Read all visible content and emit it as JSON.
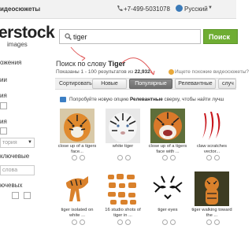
{
  "topbar": {
    "nav_text": "идеосюжеты",
    "phone": "+7-499-5031078",
    "language": "Русский",
    "language_caret": "▼"
  },
  "logo": {
    "wordmark": "erstock",
    "subtitle": "images"
  },
  "search": {
    "value": "tiger",
    "button_label": "Поиск"
  },
  "sidebar": {
    "lines": [
      "ожения",
      "ии",
      "ия",
      "ия",
      "тория",
      "ключевые",
      "слова",
      "ючевых"
    ],
    "caret": "▼"
  },
  "results": {
    "heading_prefix": "Поиск по слову",
    "heading_query": "Tiger",
    "shown_prefix": "Показаны 1 - 100 результатов из",
    "shown_count": "22,932",
    "similar_link": "Ищете похожие видеосюжеты?"
  },
  "sort": {
    "label": "Сортировать:",
    "tabs": [
      {
        "label": "Новые",
        "active": false
      },
      {
        "label": "Популярные",
        "active": true
      },
      {
        "label": "Релевантные",
        "active": false
      },
      {
        "label": "случ",
        "active": false
      }
    ]
  },
  "hint": {
    "prefix": "Попробуйте новую опцию",
    "bold": "Релевантные",
    "suffix": "сверху, чтобы найти лучш"
  },
  "images": [
    {
      "caption_line1": "close up of a tigers",
      "caption_line2": "face..."
    },
    {
      "caption_line1": "white tiger",
      "caption_line2": ""
    },
    {
      "caption_line1": "close up of a tigers",
      "caption_line2": "face with ..."
    },
    {
      "caption_line1": "claw scratches",
      "caption_line2": "vector..."
    },
    {
      "caption_line1": "tiger isolated on",
      "caption_line2": "white ..."
    },
    {
      "caption_line1": "16 studio shots of",
      "caption_line2": "tiger in ..."
    },
    {
      "caption_line1": "tiger eyes",
      "caption_line2": ""
    },
    {
      "caption_line1": "tiger walking toward",
      "caption_line2": "the ..."
    }
  ],
  "colors": {
    "search_button": "#6fad33",
    "active_tab": "#777777",
    "annotation_arrow": "#e05a5a",
    "hint_icon": "#3c7fc4"
  },
  "icons": [
    "phone-icon",
    "globe-icon",
    "search-icon",
    "info-icon",
    "similar-icon",
    "preview-icon",
    "lightbox-icon"
  ]
}
